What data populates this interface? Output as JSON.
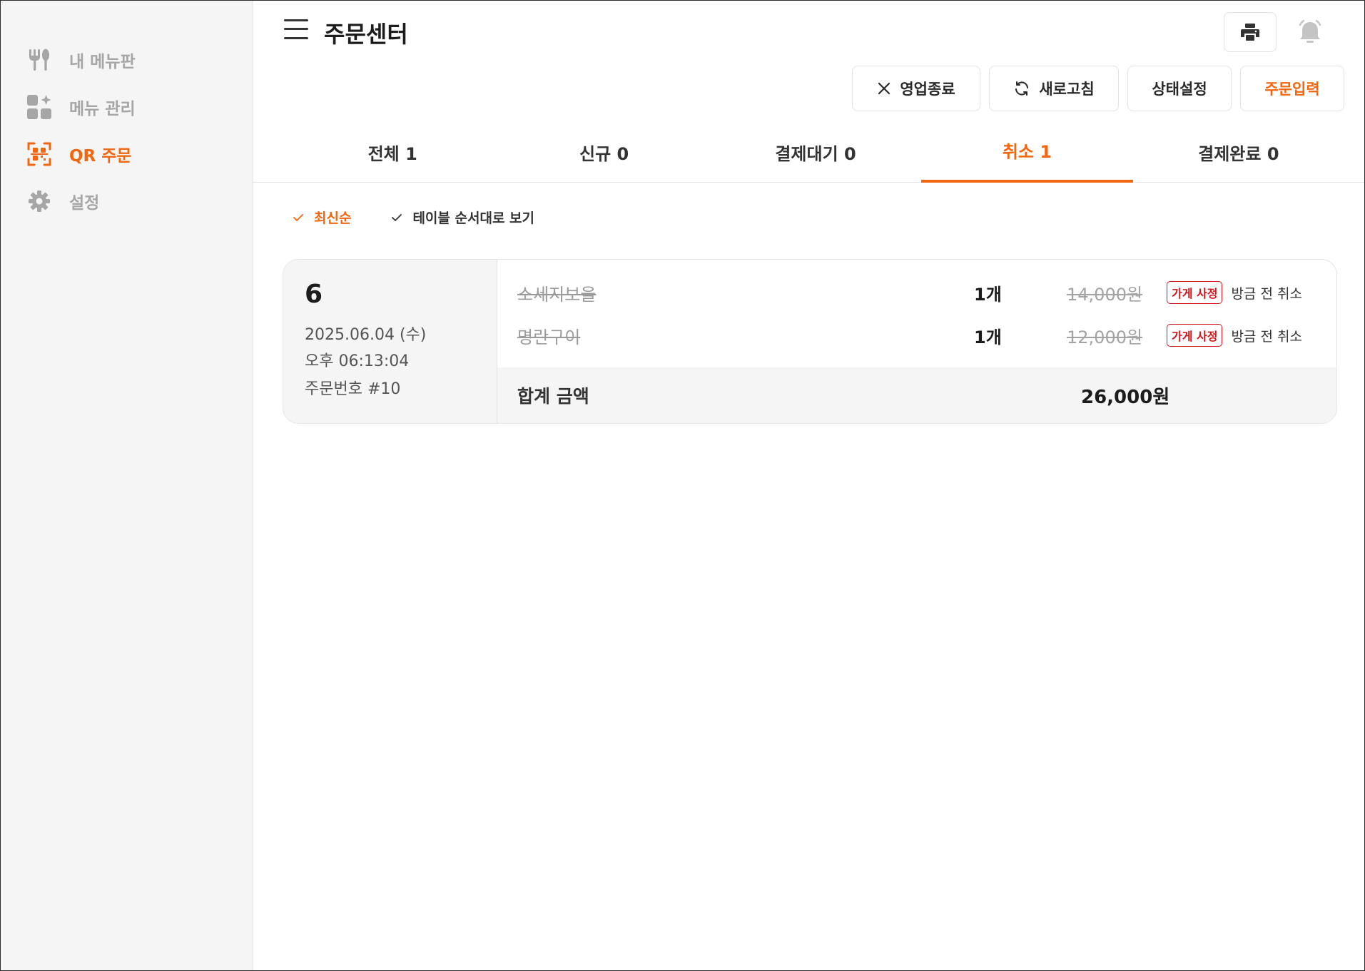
{
  "sidebar": {
    "items": [
      {
        "label": "내 메뉴판",
        "icon": "utensils-icon"
      },
      {
        "label": "메뉴 관리",
        "icon": "grid-plus-icon"
      },
      {
        "label": "QR 주문",
        "icon": "qr-scan-icon"
      },
      {
        "label": "설정",
        "icon": "gear-icon"
      }
    ],
    "active_index": 2
  },
  "header": {
    "title": "주문센터"
  },
  "actions": {
    "close_business": "영업종료",
    "refresh": "새로고침",
    "status_settings": "상태설정",
    "order_input": "주문입력"
  },
  "tabs": [
    {
      "label": "전체 1"
    },
    {
      "label": "신규 0"
    },
    {
      "label": "결제대기 0"
    },
    {
      "label": "취소 1"
    },
    {
      "label": "결제완료 0"
    }
  ],
  "active_tab": 3,
  "filters": {
    "latest": "최신순",
    "by_table": "테이블 순서대로 보기"
  },
  "order": {
    "table_number": "6",
    "date": "2025.06.04 (수)",
    "time": "오후 06:13:04",
    "order_number": "주문번호 #10",
    "items": [
      {
        "name": "소세지보울",
        "qty": "1개",
        "price": "14,000원",
        "badge": "가게 사정",
        "note": "방금 전 취소"
      },
      {
        "name": "명란구이",
        "qty": "1개",
        "price": "12,000원",
        "badge": "가게 사정",
        "note": "방금 전 취소"
      }
    ],
    "total_label": "합계 금액",
    "total_value": "26,000원"
  },
  "colors": {
    "accent": "#f2660f",
    "cancel_red": "#d3151b",
    "sidebar_bg": "#f5f5f5"
  }
}
